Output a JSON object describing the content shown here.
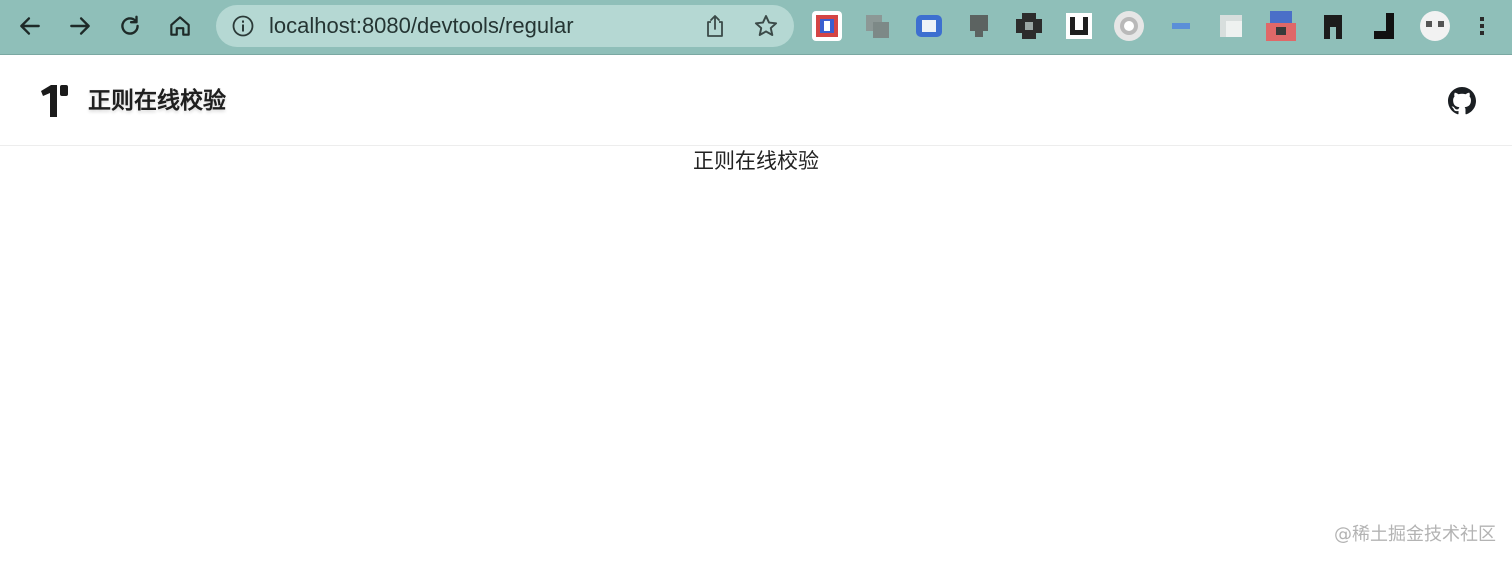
{
  "browser": {
    "url": "localhost:8080/devtools/regular",
    "toolbar_color": "#8fbfb9",
    "omnibox_color": "#b5d8d3",
    "nav_icons": [
      "back-arrow-icon",
      "forward-arrow-icon",
      "reload-icon",
      "home-icon"
    ],
    "omnibox_icons": [
      "info-icon",
      "share-icon",
      "star-icon"
    ],
    "extension_icons": [
      "extension-icon-1",
      "extension-icon-2",
      "extension-icon-3",
      "extension-icon-4",
      "extension-icon-5",
      "extension-icon-6",
      "extension-icon-7",
      "extension-icon-8",
      "extension-icon-9",
      "extension-icon-10",
      "extension-icon-11",
      "extension-icon-12",
      "extension-icon-13",
      "extension-icon-14"
    ],
    "menu_icon": "kebab-menu-icon"
  },
  "header": {
    "logo_icon": "brand-logo-icon",
    "title": "正则在线校验",
    "github_icon": "github-icon"
  },
  "main": {
    "heading": "正则在线校验"
  },
  "watermark": {
    "text": "@稀土掘金技术社区"
  }
}
